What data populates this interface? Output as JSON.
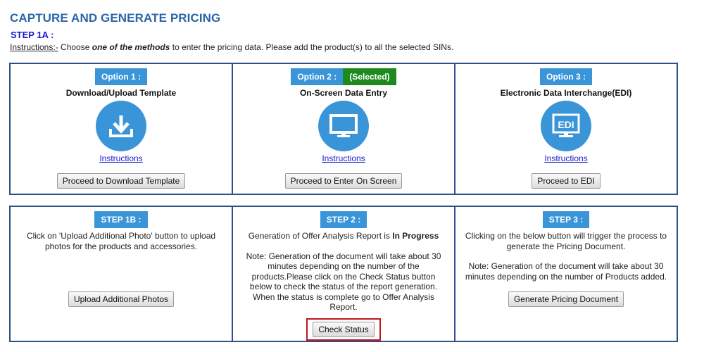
{
  "header": {
    "title": "CAPTURE AND GENERATE PRICING",
    "step": "STEP 1A :",
    "instructions_label": "Instructions:-",
    "instructions_pre": " Choose ",
    "instructions_emph": "one of the methods",
    "instructions_post": " to enter the pricing data. Please add the product(s) to all the selected SINs."
  },
  "options": [
    {
      "tag": "Option 1 :",
      "name": "Download/Upload Template",
      "icon": "download-icon",
      "link": "Instructions ",
      "button": "Proceed to Download Template"
    },
    {
      "tag": "Option 2 :",
      "selected": "(Selected)",
      "name": "On-Screen Data Entry",
      "icon": "monitor-icon",
      "link": "Instructions ",
      "button": "Proceed to Enter On Screen"
    },
    {
      "tag": "Option 3 :",
      "name": "Electronic Data Interchange(EDI)",
      "icon": "edi-icon",
      "icon_text": "EDI",
      "link": "Instructions",
      "button": "Proceed to EDI"
    }
  ],
  "steps": [
    {
      "tag": "STEP 1B :",
      "text": "Click on 'Upload Additional Photo' button to upload photos for the products and accessories.",
      "button": "Upload Additional Photos"
    },
    {
      "tag": "STEP 2 :",
      "status_pre": "Generation of Offer Analysis Report is ",
      "status": "In Progress",
      "note": "Note: Generation of the document will take about 30 minutes depending on the number of the products.Please click on the Check Status button below to check the status of the report generation. When the status is complete go to Offer Analysis Report.",
      "button": "Check Status"
    },
    {
      "tag": "STEP 3 :",
      "text": "Clicking on the below button will trigger the process to generate the Pricing Document.",
      "note": "Note: Generation of the document will take about 30 minutes depending on the number of Products added.",
      "button": "Generate Pricing Document"
    }
  ],
  "colors": {
    "title": "#2a66a6",
    "tag": "#3a95d8",
    "selected": "#1e8a1e",
    "border": "#2d4f8a",
    "highlight": "#c0181e"
  }
}
